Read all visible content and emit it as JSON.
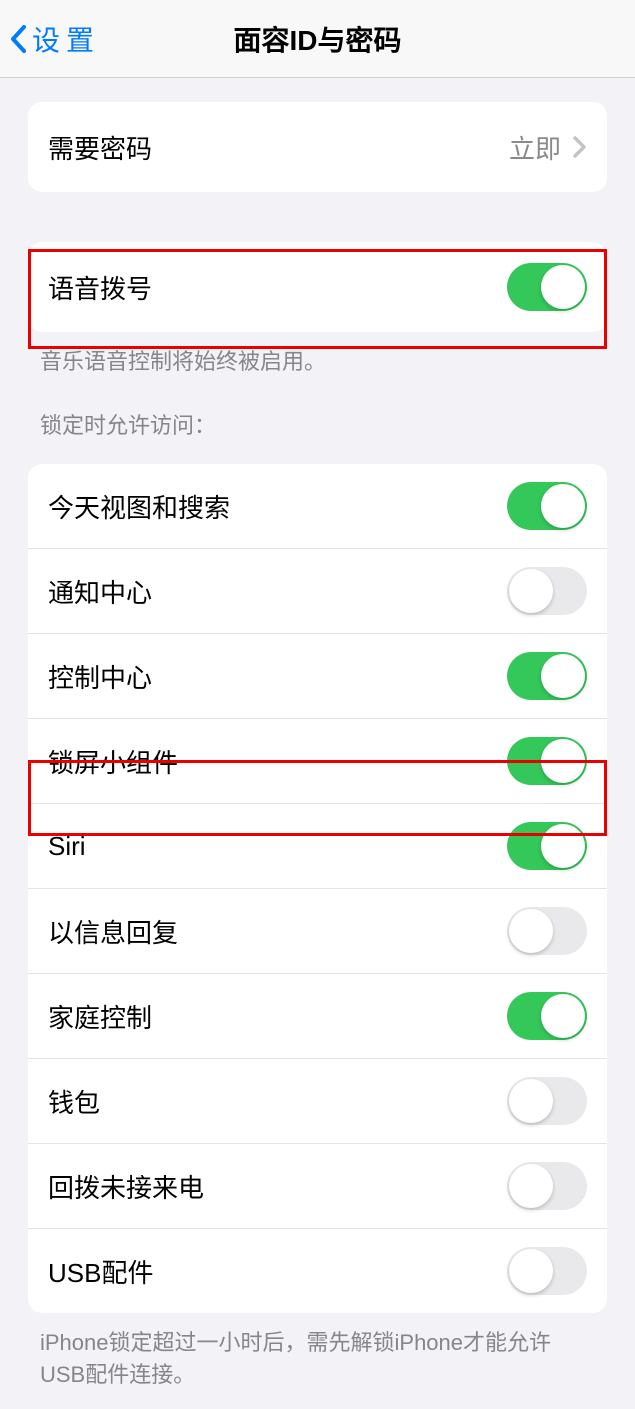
{
  "header": {
    "back_label": "设置",
    "title": "面容ID与密码"
  },
  "require_passcode": {
    "label": "需要密码",
    "value": "立即"
  },
  "voice_dial": {
    "label": "语音拨号",
    "footer": "音乐语音控制将始终被启用。",
    "on": true
  },
  "lock_section_header": "锁定时允许访问：",
  "lock_items": [
    {
      "label": "今天视图和搜索",
      "on": true
    },
    {
      "label": "通知中心",
      "on": false
    },
    {
      "label": "控制中心",
      "on": true
    },
    {
      "label": "锁屏小组件",
      "on": true
    },
    {
      "label": "Siri",
      "on": true
    },
    {
      "label": "以信息回复",
      "on": false
    },
    {
      "label": "家庭控制",
      "on": true
    },
    {
      "label": "钱包",
      "on": false
    },
    {
      "label": "回拨未接来电",
      "on": false
    },
    {
      "label": "USB配件",
      "on": false
    }
  ],
  "lock_footer": "iPhone锁定超过一小时后，需先解锁iPhone才能允许USB配件连接。"
}
